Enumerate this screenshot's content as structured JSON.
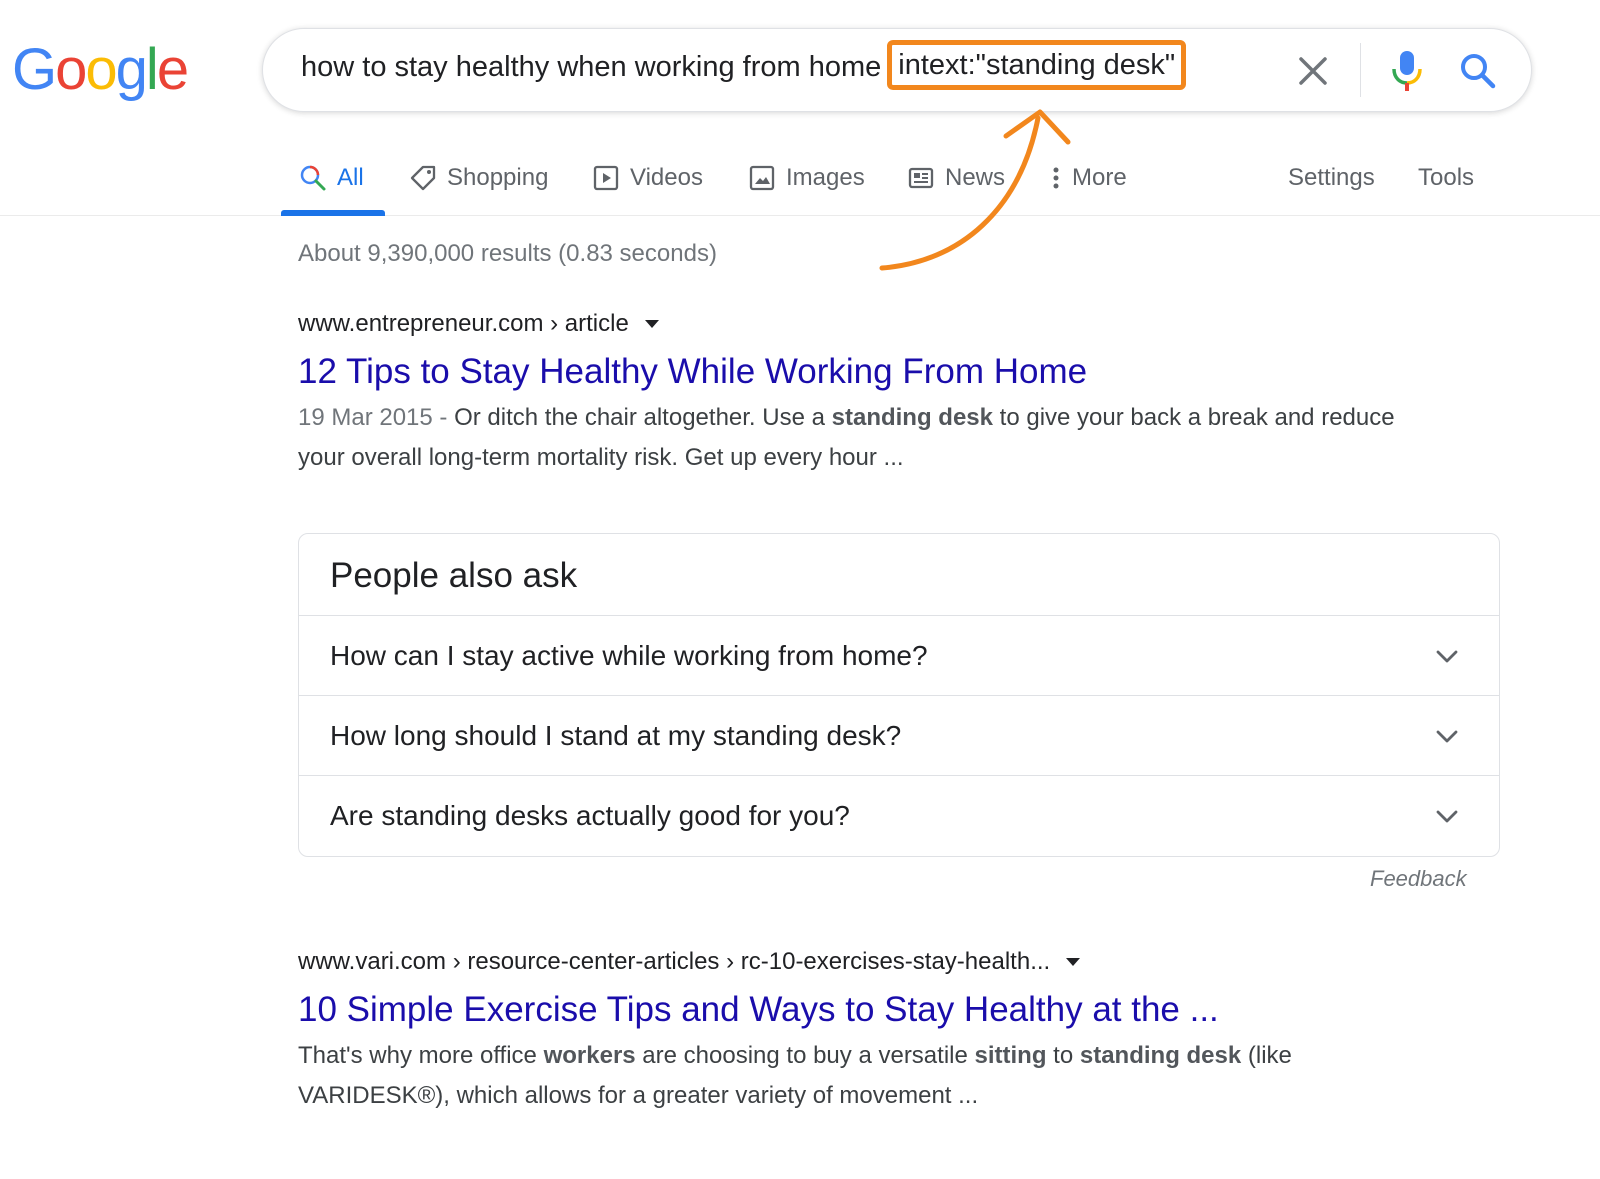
{
  "logo": {
    "letters": [
      "G",
      "o",
      "o",
      "g",
      "l",
      "e"
    ],
    "colors": [
      "#4285F4",
      "#EA4335",
      "#FBBC05",
      "#4285F4",
      "#34A853",
      "#EA4335"
    ]
  },
  "search": {
    "query_main": "how to stay healthy when working from home",
    "query_highlight": "intext:\"standing desk\"",
    "highlight_color": "#f2871d",
    "clear_icon": "close-icon",
    "mic_icon": "mic-icon",
    "search_icon": "search-icon"
  },
  "tabs": {
    "all": "All",
    "shopping": "Shopping",
    "videos": "Videos",
    "images": "Images",
    "news": "News",
    "more": "More",
    "settings": "Settings",
    "tools": "Tools"
  },
  "stats": "About 9,390,000 results (0.83 seconds)",
  "results": [
    {
      "cite": "www.entrepreneur.com › article",
      "title": "12 Tips to Stay Healthy While Working From Home",
      "date": "19 Mar 2015 - ",
      "snippet_parts": [
        "Or ditch the chair altogether. Use a ",
        "standing desk",
        " to give your back a break and reduce your overall long-term mortality risk. Get up every hour ..."
      ]
    },
    {
      "cite": "www.vari.com › resource-center-articles › rc-10-exercises-stay-health...",
      "title": "10 Simple Exercise Tips and Ways to Stay Healthy at the ...",
      "snippet_parts": [
        "That's why more office ",
        "workers",
        " are choosing to buy a versatile ",
        "sitting",
        " to ",
        "standing desk",
        " (like VARIDESK®), which allows for a greater variety of movement ..."
      ]
    }
  ],
  "people_also_ask": {
    "title": "People also ask",
    "questions": [
      "How can I stay active while working from home?",
      "How long should I stand at my standing desk?",
      "Are standing desks actually good for you?"
    ]
  },
  "feedback": "Feedback",
  "accent": "#1a73e8",
  "link_color": "#1a0dab"
}
